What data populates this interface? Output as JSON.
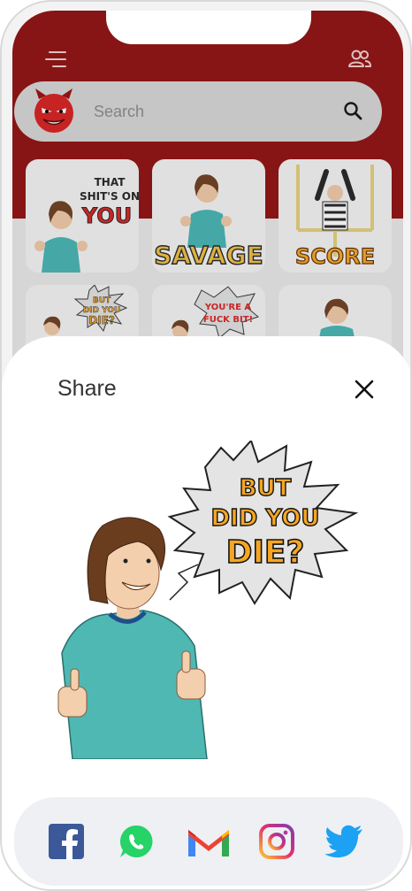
{
  "search": {
    "placeholder": "Search"
  },
  "stickers": [
    {
      "name": "that-shit-on-you-sticker",
      "caption_lines": [
        "THAT",
        "SHIT'S ON",
        "YOU"
      ]
    },
    {
      "name": "savage-sticker",
      "caption_lines": [
        "SAVAGE"
      ]
    },
    {
      "name": "score-sticker",
      "caption_lines": [
        "SCORE"
      ]
    },
    {
      "name": "but-did-you-die-sticker",
      "caption_lines": [
        "BUT",
        "DID YOU",
        "DIE?"
      ]
    },
    {
      "name": "youre-a-fuck-bit-sticker",
      "caption_lines": [
        "YOU'RE A",
        "FUCK BIT!"
      ]
    },
    {
      "name": "guy-sticker",
      "caption_lines": []
    }
  ],
  "share_sheet": {
    "title": "Share",
    "preview_caption_lines": [
      "BUT",
      "DID YOU",
      "DIE?"
    ],
    "targets": [
      "facebook",
      "whatsapp",
      "gmail",
      "instagram",
      "twitter"
    ]
  },
  "colors": {
    "header": "#8f0d0d",
    "facebook": "#3b5998",
    "whatsapp": "#25d366",
    "gmail": "#ea4335",
    "instagram": "#c13584",
    "twitter": "#1da1f2",
    "sticker_text": "#f6a623"
  }
}
